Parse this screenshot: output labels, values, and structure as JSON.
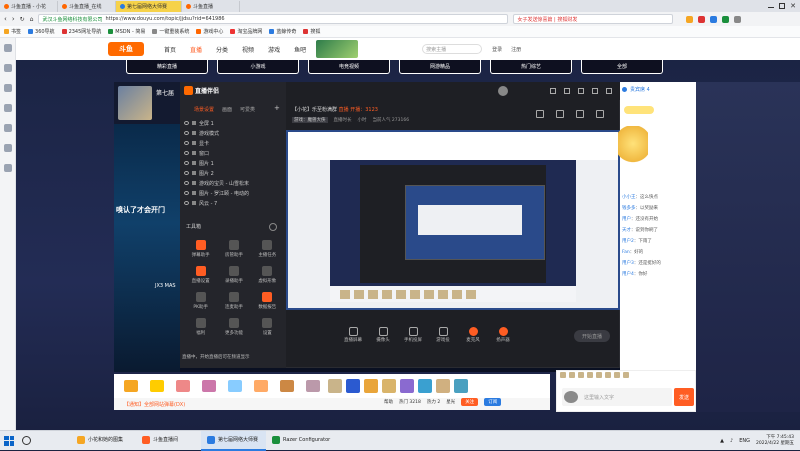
{
  "browser": {
    "tabs": [
      {
        "label": "斗鱼直播 - 小花"
      },
      {
        "label": "斗鱼直播_在线",
        "active": false
      },
      {
        "label": "第七届网络大师赛",
        "active": true
      },
      {
        "label": "斗鱼直播"
      }
    ],
    "url_secure_label": "武汉斗鱼网络科技有限公司",
    "url": "https://www.douyu.com/topic/jjdsu?rid=641986",
    "search_placeholder": "女子发送惊喜篇 | 搜狐财发",
    "bookmarks": [
      "书签",
      "360导航",
      "2345网址导航",
      "MSDN - 简易",
      "一键重装系统",
      "游戏中心",
      "淘宝品牌网",
      "蓝鲸传奇",
      "搜狐"
    ]
  },
  "douyu": {
    "logo": "斗鱼",
    "nav": [
      {
        "label": "首页"
      },
      {
        "label": "直播",
        "active": true
      },
      {
        "label": "分类"
      },
      {
        "label": "视频"
      },
      {
        "label": "游戏"
      },
      {
        "label": "鱼吧"
      }
    ],
    "search_placeholder": "搜索主播",
    "nav_right": [
      "登录",
      "注册"
    ],
    "category_tabs": [
      "精彩直播",
      "小游戏",
      "电竞视频",
      "网游精品",
      "热门综艺",
      "全部"
    ]
  },
  "stream": {
    "anchor_name": "第七届",
    "game_overlay_text": "嗅认了才会开门",
    "game_label": "JX3 MAS",
    "gift_bar_text": "【通知】全部网站弹幕(DX)"
  },
  "app": {
    "logo_text": "直播伴侣",
    "scene_tabs": [
      "场景设置",
      "画面",
      "可爱类"
    ],
    "scenes": [
      "全屏 1",
      "游戏模式",
      "显卡",
      "窗口",
      "图片 1",
      "图片 2",
      "游戏的宝贝 - 山雪松末",
      "图片 - 罗江颐 - 电动的",
      "风云 - 7"
    ],
    "tools_title": "工具箱",
    "tools": [
      {
        "label": "弹幕助手",
        "hot": true
      },
      {
        "label": "房管助手"
      },
      {
        "label": "主播任务"
      },
      {
        "label": "直播设置",
        "hot": true
      },
      {
        "label": "录播助手"
      },
      {
        "label": "虚拟形象"
      },
      {
        "label": "PK助手"
      },
      {
        "label": "连麦助手"
      },
      {
        "label": "数据报告",
        "hot": true
      },
      {
        "label": "福利"
      },
      {
        "label": "更多功能"
      },
      {
        "label": "设置"
      }
    ],
    "status": "直播中，开始直播后可在频道显示",
    "room_title": "【小花】乐至粉满群",
    "room_badge": "直播",
    "room_notice": "开播：3123",
    "room_info": [
      "游戏：魔兽大侠",
      "直播时长",
      "小时",
      "当前人气 273166"
    ],
    "bottom_buttons": [
      {
        "label": "直播屏幕"
      },
      {
        "label": "摄像头"
      },
      {
        "label": "手机投屏"
      },
      {
        "label": "游戏投"
      },
      {
        "label": "麦克风"
      },
      {
        "label": "扬声器"
      }
    ],
    "start_button": "开始直播"
  },
  "footer_stats": [
    "帮助",
    "热门 3218",
    "热力 2",
    "星光"
  ],
  "footer_btn_orange": "关注",
  "footer_btn_blue": "订阅",
  "chat": {
    "header": "贵宾席 4",
    "messages": [
      {
        "user": "小小王",
        "text": "这么快点"
      },
      {
        "user": "钱多多",
        "text": "以奖励来"
      },
      {
        "user": "用户",
        "text": "还没有开始"
      },
      {
        "user": "天才",
        "text": "说到你刷了"
      },
      {
        "user": "用户2",
        "text": "下雨了"
      },
      {
        "user": "Fan",
        "text": "好的"
      },
      {
        "user": "用户3",
        "text": "还是挺好的"
      },
      {
        "user": "用户4",
        "text": "你好"
      }
    ],
    "input_placeholder": "这里输入文字",
    "send_label": "发送"
  },
  "taskbar": {
    "items": [
      {
        "label": "小花和她的图集"
      },
      {
        "label": "斗鱼直播间"
      },
      {
        "label": "第七届网络大师赛",
        "active": true
      },
      {
        "label": "Razer Configurator"
      }
    ],
    "lang": "ENG",
    "time": "下午 7:45:43",
    "date": "2022/4/22 星期五"
  }
}
